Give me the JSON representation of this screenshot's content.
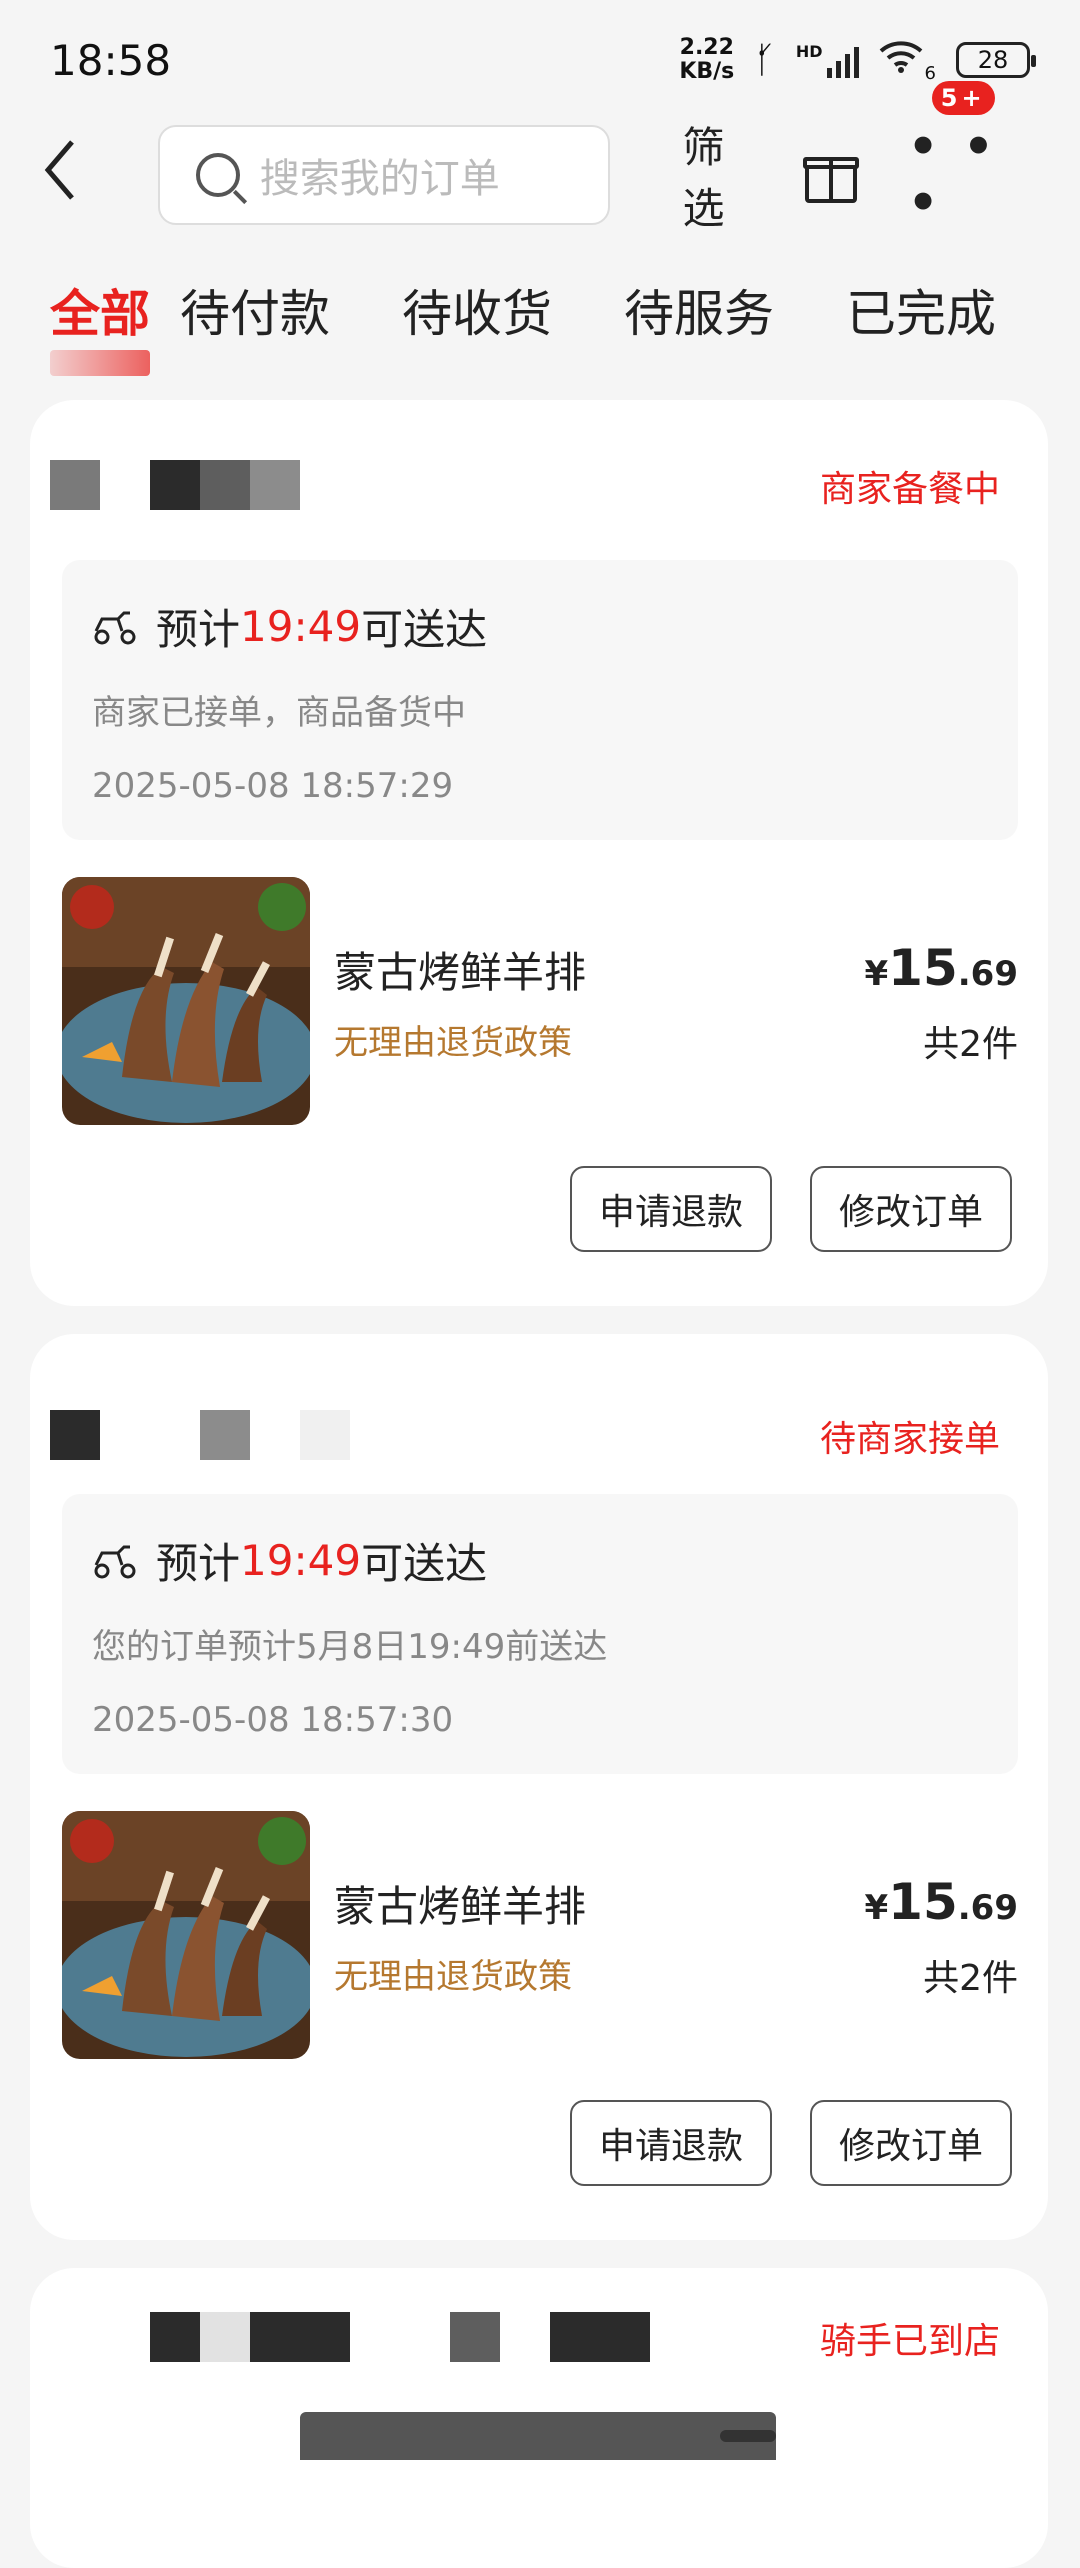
{
  "status_bar": {
    "time": "18:58",
    "net_speed_value": "2.22",
    "net_speed_unit": "KB/s",
    "signal_label": "HD",
    "wifi_label": "6",
    "battery": "28"
  },
  "header": {
    "back_icon": "chevron-left-icon",
    "search_placeholder": "搜索我的订单",
    "filter_label": "筛选",
    "badge": "5+"
  },
  "tabs": [
    {
      "label": "全部",
      "active": true
    },
    {
      "label": "待付款",
      "active": false
    },
    {
      "label": "待收货",
      "active": false
    },
    {
      "label": "待服务",
      "active": false
    },
    {
      "label": "已完成",
      "active": false
    }
  ],
  "orders": [
    {
      "status": "商家备餐中",
      "eta_prefix": "预计",
      "eta_time": "19:49",
      "eta_suffix": "可送达",
      "sub_text": "商家已接单，商品备货中",
      "timestamp": "2025-05-08 18:57:29",
      "item_name": "蒙古烤鲜羊排",
      "policy": "无理由退货政策",
      "price_symbol": "¥",
      "price_int": "15",
      "price_dec": ".69",
      "quantity": "共2件",
      "btn_refund": "申请退款",
      "btn_modify": "修改订单"
    },
    {
      "status": "待商家接单",
      "eta_prefix": "预计",
      "eta_time": "19:49",
      "eta_suffix": "可送达",
      "sub_text": "您的订单预计5月8日19:49前送达",
      "timestamp": "2025-05-08 18:57:30",
      "item_name": "蒙古烤鲜羊排",
      "policy": "无理由退货政策",
      "price_symbol": "¥",
      "price_int": "15",
      "price_dec": ".69",
      "quantity": "共2件",
      "btn_refund": "申请退款",
      "btn_modify": "修改订单"
    },
    {
      "status": "骑手已到店"
    }
  ],
  "colors": {
    "accent": "#e8221f",
    "policy": "#b5782f"
  }
}
